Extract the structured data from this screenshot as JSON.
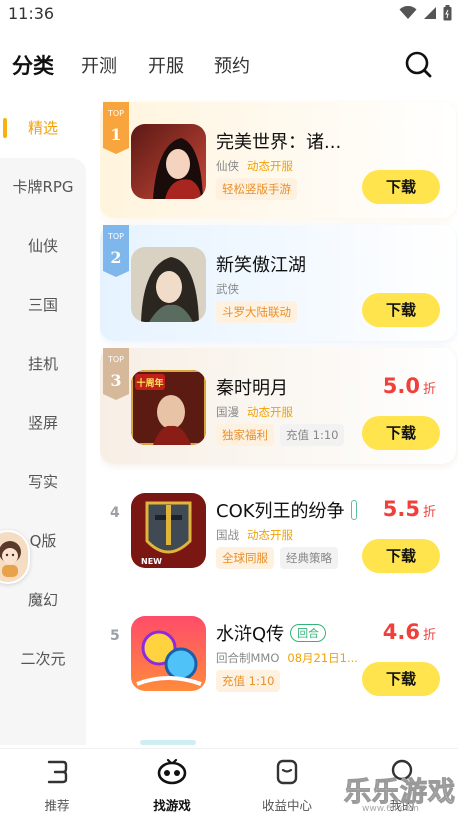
{
  "status": {
    "time": "11:36"
  },
  "top_tabs": [
    {
      "label": "分类",
      "active": true
    },
    {
      "label": "开测"
    },
    {
      "label": "开服"
    },
    {
      "label": "预约"
    }
  ],
  "sidebar": {
    "items": [
      {
        "label": "精选",
        "active": true
      },
      {
        "label": "卡牌RPG"
      },
      {
        "label": "仙侠"
      },
      {
        "label": "三国"
      },
      {
        "label": "挂机"
      },
      {
        "label": "竖屏"
      },
      {
        "label": "写实"
      },
      {
        "label": "Q版"
      },
      {
        "label": "魔幻"
      },
      {
        "label": "二次元"
      }
    ]
  },
  "games": [
    {
      "rank": "1",
      "ribbon": "TOP",
      "title": "完美世界：诸...",
      "genre": "仙侠",
      "extra": "动态开服",
      "tags": [
        {
          "text": "轻松竖版手游",
          "style": "orange"
        }
      ],
      "button": "下载"
    },
    {
      "rank": "2",
      "ribbon": "TOP",
      "title": "新笑傲江湖",
      "genre": "武侠",
      "extra": "",
      "tags": [
        {
          "text": "斗罗大陆联动",
          "style": "orange"
        }
      ],
      "button": "下载"
    },
    {
      "rank": "3",
      "ribbon": "TOP",
      "title": "秦时明月",
      "genre": "国漫",
      "extra": "动态开服",
      "tags": [
        {
          "text": "独家福利",
          "style": "orange"
        },
        {
          "text": "充值 1:10",
          "style": "gray"
        }
      ],
      "discount": "5.0",
      "discount_unit": "折",
      "icon_text": "十周年",
      "button": "下载"
    },
    {
      "rank": "4",
      "title": "COK列王的纷争",
      "genre": "国战",
      "extra": "动态开服",
      "tags": [
        {
          "text": "全球同服",
          "style": "orange"
        },
        {
          "text": "经典策略",
          "style": "gray"
        }
      ],
      "discount": "5.5",
      "discount_unit": "折",
      "icon_text": "NEW",
      "button": "下载"
    },
    {
      "rank": "5",
      "title": "水浒Q传",
      "badge": "回合",
      "genre": "回合制MMO",
      "date": "08月21日1...",
      "tags": [
        {
          "text": "充值 1:10",
          "style": "orange"
        }
      ],
      "discount": "4.6",
      "discount_unit": "折",
      "button": "下载"
    }
  ],
  "bottom_nav": [
    {
      "label": "推荐",
      "icon": "recommend-icon"
    },
    {
      "label": "找游戏",
      "icon": "gamepad-icon",
      "active": true
    },
    {
      "label": "收益中心",
      "icon": "wallet-icon"
    },
    {
      "label": "我的",
      "icon": "profile-icon"
    }
  ],
  "watermark": {
    "text": "乐乐游戏",
    "url": "www.6ll.com"
  },
  "colors": {
    "accent": "#f8b20f",
    "download_button": "#ffe44d",
    "discount": "#f0403c",
    "tag_orange": "#e8902b"
  }
}
